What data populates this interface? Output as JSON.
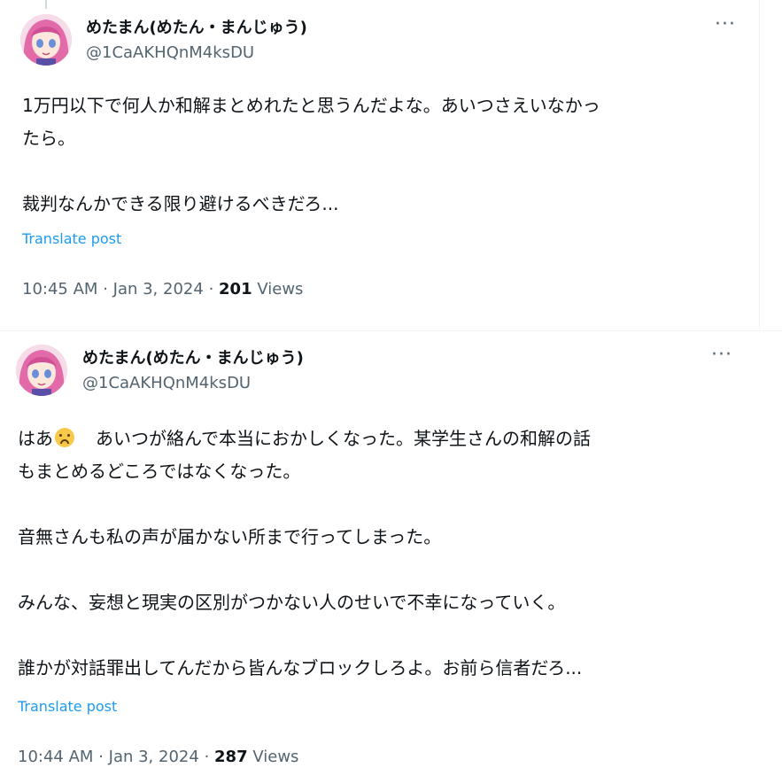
{
  "tweets": [
    {
      "author": {
        "display_name": "めたまん(めたん・まんじゅう)",
        "handle": "@1CaAKHQnM4ksDU"
      },
      "more_label": "···",
      "text": "1万円以下で何人か和解まとめれたと思うんだよな。あいつさえいなかっ\nたら。\n\n裁判なんかできる限り避けるべきだろ...",
      "translate_label": "Translate post",
      "time": "10:45 AM",
      "date": "Jan 3, 2024",
      "views_count": "201",
      "views_label": "Views"
    },
    {
      "author": {
        "display_name": "めたまん(めたん・まんじゅう)",
        "handle": "@1CaAKHQnM4ksDU"
      },
      "more_label": "···",
      "text_prefix": "はあ",
      "emoji": "weary-face-emoji",
      "text_rest": "　あいつが絡んで本当におかしくなった。某学生さんの和解の話\nもまとめるどころではなくなった。\n\n音無さんも私の声が届かない所まで行ってしまった。\n\nみんな、妄想と現実の区別がつかない人のせいで不幸になっていく。\n\n誰かが対話罪出してんだから皆んなブロックしろよ。お前ら信者だろ...",
      "translate_label": "Translate post",
      "time": "10:44 AM",
      "date": "Jan 3, 2024",
      "views_count": "287",
      "views_label": "Views"
    }
  ],
  "colors": {
    "text": "#0f1419",
    "secondary": "#536471",
    "link": "#1d9bf0",
    "divider": "#eff3f4"
  },
  "icons": {
    "avatar": "avatar-illustration",
    "more": "more-options-icon"
  }
}
